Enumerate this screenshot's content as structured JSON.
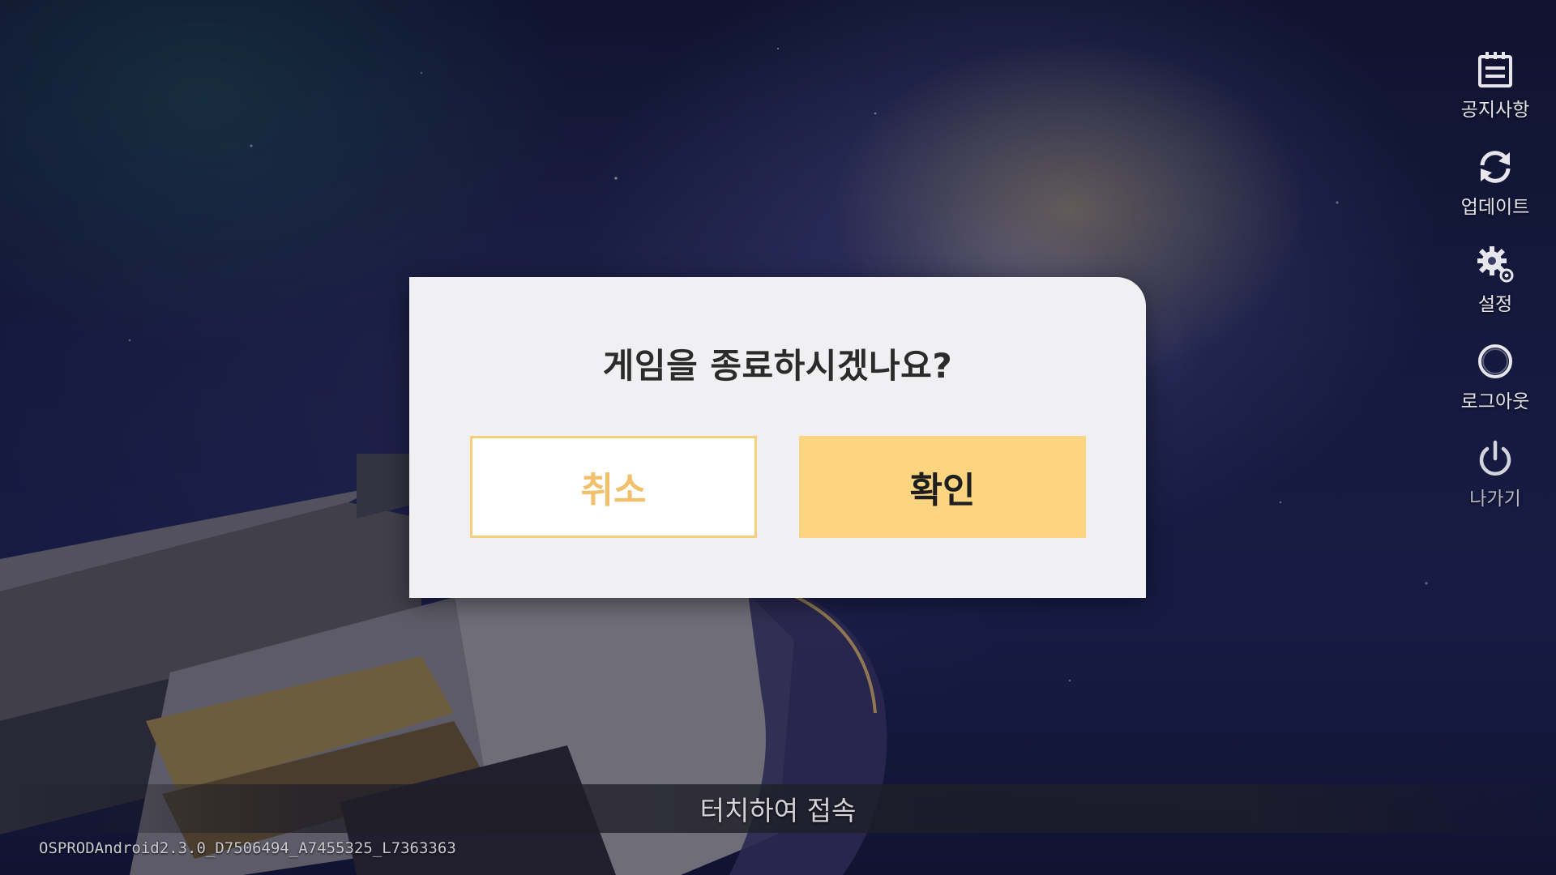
{
  "side_menu": {
    "items": [
      {
        "id": "notice",
        "label": "공지사항",
        "icon": "notice-board-icon"
      },
      {
        "id": "update",
        "label": "업데이트",
        "icon": "refresh-icon"
      },
      {
        "id": "settings",
        "label": "설정",
        "icon": "gear-icon"
      },
      {
        "id": "logout",
        "label": "로그아웃",
        "icon": "logout-ring-icon"
      },
      {
        "id": "exit",
        "label": "나가기",
        "icon": "power-icon"
      }
    ]
  },
  "dialog": {
    "title": "게임을 종료하시겠나요?",
    "cancel_label": "취소",
    "confirm_label": "확인"
  },
  "footer": {
    "touch_prompt": "터치하여 접속",
    "version": "OSPRODAndroid2.3.0_D7506494_A7455325_L7363363"
  },
  "colors": {
    "accent": "#fdd47f",
    "cancel_text": "#f2c06b",
    "dialog_bg": "#f0f0f2"
  }
}
